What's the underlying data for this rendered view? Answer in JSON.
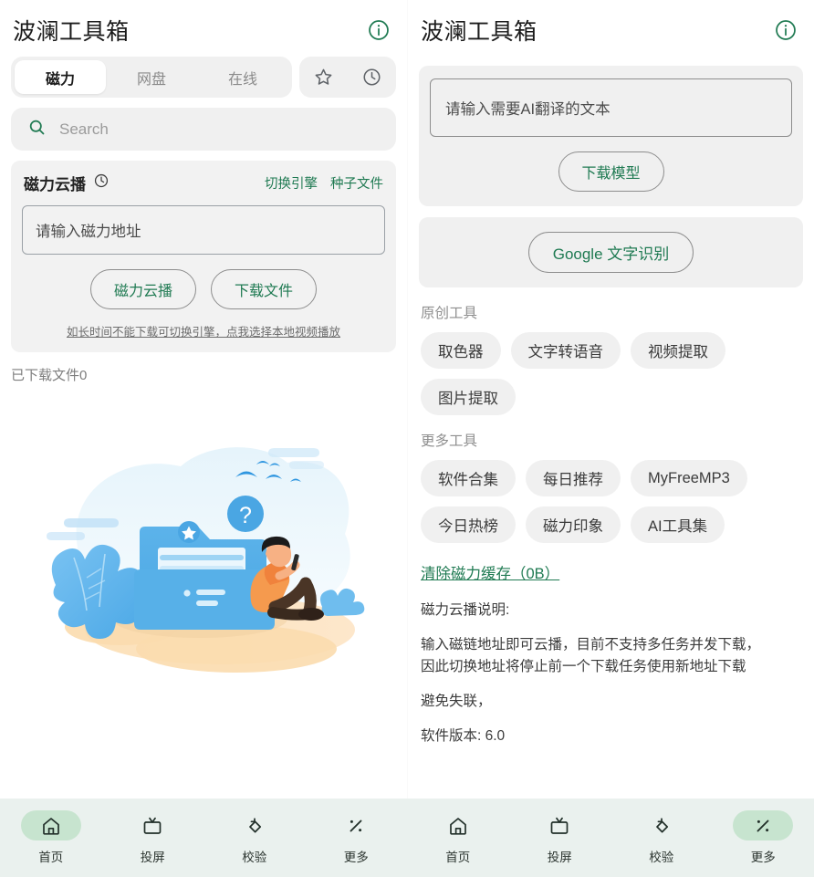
{
  "theme": {
    "accent_green": "#1f7a52",
    "nav_bg": "#eaf1ee",
    "nav_active_pill": "#c7e4cf",
    "card_bg": "#f0f0f0",
    "chip_bg": "#f0f0f0"
  },
  "left": {
    "header": {
      "title": "波澜工具箱",
      "info_icon": "info-circle-icon"
    },
    "tabs": [
      {
        "label": "磁力",
        "active": true
      },
      {
        "label": "网盘",
        "active": false
      },
      {
        "label": "在线",
        "active": false
      }
    ],
    "tab_actions": [
      {
        "icon": "star-icon"
      },
      {
        "icon": "clock-icon"
      }
    ],
    "search": {
      "icon": "search-icon",
      "placeholder": "Search",
      "value": ""
    },
    "magnet": {
      "title": "磁力云播",
      "title_icon": "clock-icon",
      "links": [
        "切换引擎",
        "种子文件"
      ],
      "input_placeholder": "请输入磁力地址",
      "input_value": "",
      "buttons": [
        "磁力云播",
        "下载文件"
      ],
      "hint": "如长时间不能下载可切换引擎，点我选择本地视频播放"
    },
    "downloaded_text": "已下载文件0",
    "illustration": "empty-state-folder-person-illustration"
  },
  "right": {
    "header": {
      "title": "波澜工具箱",
      "info_icon": "info-circle-icon"
    },
    "translate_card": {
      "input_placeholder": "请输入需要AI翻译的文本",
      "input_value": "",
      "button": "下载模型"
    },
    "ocr_card": {
      "button": "Google 文字识别"
    },
    "original_tools": {
      "label": "原创工具",
      "chips": [
        "取色器",
        "文字转语音",
        "视频提取",
        "图片提取"
      ]
    },
    "more_tools": {
      "label": "更多工具",
      "chips": [
        "软件合集",
        "每日推荐",
        "MyFreeMP3",
        "今日热榜",
        "磁力印象",
        "AI工具集"
      ]
    },
    "clear_cache": "清除磁力缓存（0B）",
    "description": {
      "heading": "磁力云播说明:",
      "para_line1": "输入磁链地址即可云播，目前不支持多任务并发下载，",
      "para_line2": "因此切换地址将停止前一个下载任务使用新地址下载",
      "para2": "避免失联，",
      "version": "软件版本: 6.0"
    }
  },
  "bottom_nav_left": {
    "items": [
      {
        "label": "首页",
        "icon": "home-icon",
        "active": true
      },
      {
        "label": "投屏",
        "icon": "cast-tv-icon",
        "active": false
      },
      {
        "label": "校验",
        "icon": "rotate-verify-icon",
        "active": false
      },
      {
        "label": "更多",
        "icon": "percent-more-icon",
        "active": false
      }
    ]
  },
  "bottom_nav_right": {
    "items": [
      {
        "label": "首页",
        "icon": "home-icon",
        "active": false
      },
      {
        "label": "投屏",
        "icon": "cast-tv-icon",
        "active": false
      },
      {
        "label": "校验",
        "icon": "rotate-verify-icon",
        "active": false
      },
      {
        "label": "更多",
        "icon": "percent-more-icon",
        "active": true
      }
    ]
  }
}
